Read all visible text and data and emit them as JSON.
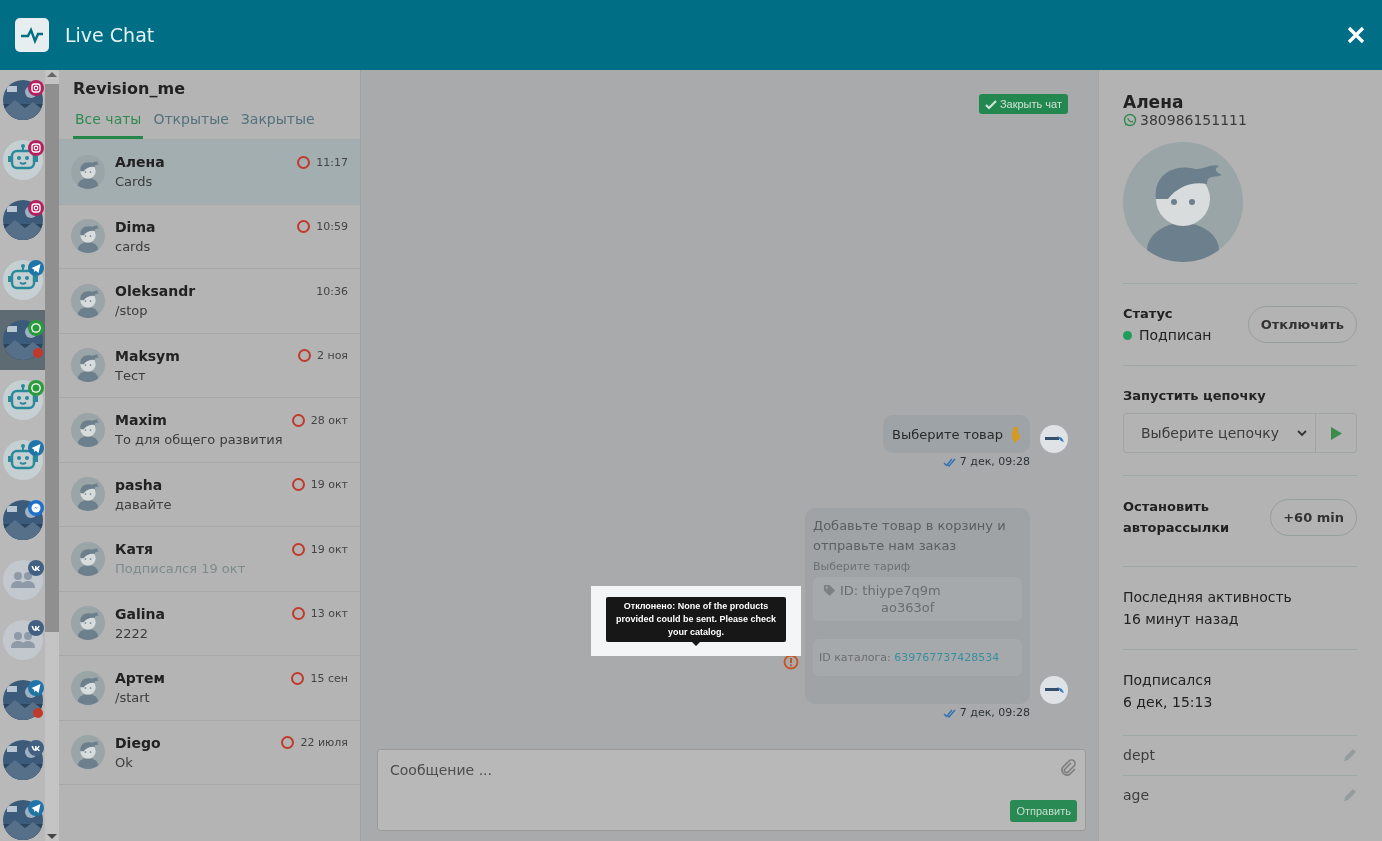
{
  "header": {
    "title": "Live Chat"
  },
  "channels": [
    {
      "badge": {
        "kind": "instagram"
      },
      "selected": false,
      "unread": false
    },
    {
      "kind": "robot",
      "badge": {
        "kind": "instagram"
      },
      "selected": false,
      "unread": false
    },
    {
      "badge": {
        "kind": "instagram"
      },
      "selected": false,
      "unread": false
    },
    {
      "kind": "robot",
      "badge": {
        "kind": "telegram"
      },
      "selected": false,
      "unread": false
    },
    {
      "badge": {
        "kind": "whatsapp"
      },
      "selected": true,
      "unread": true
    },
    {
      "kind": "robot",
      "badge": {
        "kind": "whatsapp"
      },
      "selected": false,
      "unread": false
    },
    {
      "kind": "robot",
      "badge": {
        "kind": "telegram"
      },
      "selected": false,
      "unread": false
    },
    {
      "badge": {
        "kind": "messenger"
      },
      "selected": false,
      "unread": false
    },
    {
      "kind": "group",
      "badge": {
        "kind": "vk"
      },
      "selected": false,
      "unread": false
    },
    {
      "kind": "group",
      "badge": {
        "kind": "vk"
      },
      "selected": false,
      "unread": false
    },
    {
      "badge": {
        "kind": "telegram"
      },
      "selected": false,
      "unread": true
    },
    {
      "badge": {
        "kind": "vk"
      },
      "selected": false,
      "unread": false
    },
    {
      "badge": {
        "kind": "telegram"
      },
      "selected": false,
      "unread": false
    }
  ],
  "chat_list": {
    "title": "Revision_me",
    "tabs": [
      {
        "label": "Все чаты",
        "selected": true
      },
      {
        "label": "Открытые",
        "selected": false
      },
      {
        "label": "Закрытые",
        "selected": false
      }
    ],
    "chats": [
      {
        "name": "Алена",
        "preview": "Cards",
        "time": "11:17",
        "pending": true,
        "muted": false,
        "selected": true
      },
      {
        "name": "Dima",
        "preview": "cards",
        "time": "10:59",
        "pending": true,
        "muted": false,
        "selected": false
      },
      {
        "name": "Oleksandr",
        "preview": "/stop",
        "time": "10:36",
        "pending": false,
        "muted": false,
        "selected": false
      },
      {
        "name": "Maksym",
        "preview": "Тест",
        "time": "2 ноя",
        "pending": true,
        "muted": false,
        "selected": false
      },
      {
        "name": "Maxim",
        "preview": "То для общего развития",
        "time": "28 окт",
        "pending": true,
        "muted": false,
        "selected": false
      },
      {
        "name": "pasha",
        "preview": "давайте",
        "time": "19 окт",
        "pending": true,
        "muted": false,
        "selected": false
      },
      {
        "name": "Катя",
        "preview": "Подписался 19 окт",
        "time": "19 окт",
        "pending": true,
        "muted": true,
        "selected": false
      },
      {
        "name": "Galina",
        "preview": "2222",
        "time": "13 окт",
        "pending": true,
        "muted": false,
        "selected": false
      },
      {
        "name": "Артем",
        "preview": "/start",
        "time": "15 сен",
        "pending": true,
        "muted": false,
        "selected": false
      },
      {
        "name": "Diego",
        "preview": "Ok",
        "time": "22 июля",
        "pending": true,
        "muted": false,
        "selected": false
      }
    ]
  },
  "chat": {
    "close_button": "Закрыть чат",
    "messages": [
      {
        "kind": "text",
        "text": "Выберите товар",
        "time": "7 дек, 09:28"
      },
      {
        "kind": "catalog",
        "title": "Добавьте товар в корзину и отправьте нам заказ",
        "subtitle": "Выберите тариф",
        "product_lines": [
          "ID: thiype7q9m",
          "ao363of"
        ],
        "catalog_label": "ID каталога:",
        "catalog_id": "639767737428534",
        "error_tooltip": "Отклонено: None of the products provided could be sent. Please check your catalog.",
        "time": "7 дек, 09:28"
      }
    ],
    "composer": {
      "placeholder": "Сообщение ...",
      "send_button": "Отправить"
    }
  },
  "contact": {
    "name": "Алена",
    "phone": "380986151111",
    "status_label": "Статус",
    "status": {
      "text": "Подписан",
      "color": "#1e9e5a"
    },
    "unsubscribe_button": "Отключить",
    "chain_label": "Запустить цепочку",
    "chain_placeholder": "Выберите цепочку",
    "pause_label": "Остановить авторассылки",
    "pause_button": "+60 min",
    "last_activity_label": "Последняя активность",
    "last_activity": "16 минут назад",
    "subscribed_label": "Подписался",
    "subscribed": "6 дек, 15:13",
    "fields": [
      "dept",
      "age"
    ]
  }
}
